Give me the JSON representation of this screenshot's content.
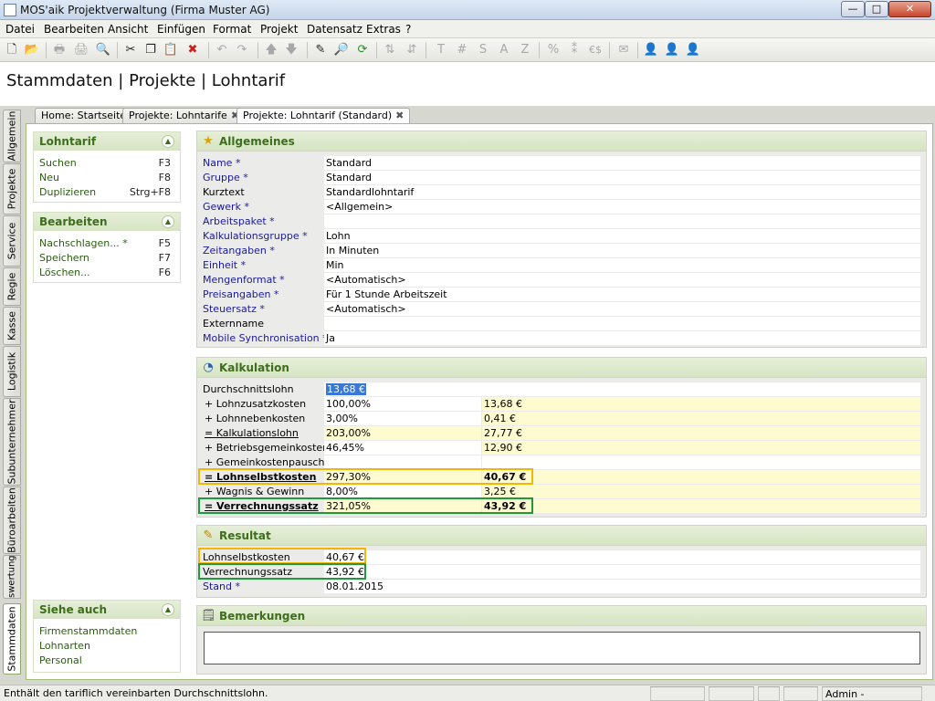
{
  "window": {
    "title": "MOS'aik Projektverwaltung (Firma Muster AG)",
    "buttons": {
      "minimize": "—",
      "maximize": "□",
      "close": "✕"
    }
  },
  "menu": [
    "Datei",
    "Bearbeiten",
    "Ansicht",
    "Einfügen",
    "Format",
    "Projekt",
    "Datensatz",
    "Extras",
    "?"
  ],
  "toolbar": {
    "icons": [
      {
        "name": "new-document-icon",
        "glyph": "🗋"
      },
      {
        "name": "open-folder-icon",
        "glyph": "📂"
      },
      {
        "name": "print-icon",
        "glyph": "🖶"
      },
      {
        "name": "print-setup-icon",
        "glyph": "🖨"
      },
      {
        "name": "print-preview-icon",
        "glyph": "🔍"
      },
      {
        "name": "cut-icon",
        "glyph": "✂"
      },
      {
        "name": "copy-icon",
        "glyph": "❐"
      },
      {
        "name": "paste-icon",
        "glyph": "📋"
      },
      {
        "name": "delete-icon",
        "glyph": "✖"
      },
      {
        "name": "undo-icon",
        "glyph": "↶"
      },
      {
        "name": "redo-icon",
        "glyph": "↷"
      },
      {
        "name": "move-up-icon",
        "glyph": "🡅"
      },
      {
        "name": "move-down-icon",
        "glyph": "🡇"
      },
      {
        "name": "edit-pencil-icon",
        "glyph": "✎"
      },
      {
        "name": "find-icon",
        "glyph": "🔎"
      },
      {
        "name": "refresh-icon",
        "glyph": "⟳"
      },
      {
        "name": "sort-ascending-icon",
        "glyph": "⇅"
      },
      {
        "name": "sort-descending-icon",
        "glyph": "⇵"
      },
      {
        "name": "text-format-icon",
        "glyph": "T"
      },
      {
        "name": "hash-format-icon",
        "glyph": "#"
      },
      {
        "name": "s-format-icon",
        "glyph": "S"
      },
      {
        "name": "a-format-icon",
        "glyph": "A"
      },
      {
        "name": "z-format-icon",
        "glyph": "Z"
      },
      {
        "name": "percent-icon",
        "glyph": "%"
      },
      {
        "name": "decimal-icon",
        "glyph": "⁑"
      },
      {
        "name": "currency-icon",
        "glyph": "€$"
      },
      {
        "name": "mail-icon",
        "glyph": "✉"
      },
      {
        "name": "user-blue-icon",
        "glyph": "👤"
      },
      {
        "name": "user-yellow-icon",
        "glyph": "👤"
      },
      {
        "name": "user-red-icon",
        "glyph": "👤"
      }
    ]
  },
  "page_heading": "Stammdaten | Projekte | Lohntarif",
  "vertical_tabs": [
    "Allgemein",
    "Projekte",
    "Service",
    "Regie",
    "Kasse",
    "Logistik",
    "Subunternehmer",
    "Büroarbeiten",
    "Auswertungen",
    "Stammdaten"
  ],
  "doc_tabs": [
    {
      "label": "Home: Startseite",
      "closable": false
    },
    {
      "label": "Projekte: Lohntarife",
      "closable": true
    },
    {
      "label": "Projekte: Lohntarif (Standard)",
      "closable": true
    }
  ],
  "close_glyph": "✖",
  "chevron_glyph": "▲",
  "left_panels": {
    "lohntarif": {
      "title": "Lohntarif",
      "items": [
        {
          "label": "Suchen",
          "key": "F3"
        },
        {
          "label": "Neu",
          "key": "F8"
        },
        {
          "label": "Duplizieren",
          "key": "Strg+F8"
        }
      ]
    },
    "bearbeiten": {
      "title": "Bearbeiten",
      "items": [
        {
          "label": "Nachschlagen... *",
          "key": "F5"
        },
        {
          "label": "Speichern",
          "key": "F7"
        },
        {
          "label": "Löschen...",
          "key": "F6"
        }
      ]
    },
    "siehe_auch": {
      "title": "Siehe auch",
      "items": [
        {
          "label": "Firmenstammdaten"
        },
        {
          "label": "Lohnarten"
        },
        {
          "label": "Personal"
        }
      ]
    }
  },
  "allgemeines": {
    "title": "Allgemeines",
    "icon": "★",
    "rows": [
      {
        "label": "Name *",
        "value": "Standard"
      },
      {
        "label": "Gruppe *",
        "value": "Standard"
      },
      {
        "label": "Kurztext",
        "value": "Standardlohntarif"
      },
      {
        "label": "Gewerk *",
        "value": "<Allgemein>"
      },
      {
        "label": "Arbeitspaket *",
        "value": ""
      },
      {
        "label": "Kalkulationsgruppe *",
        "value": "Lohn"
      },
      {
        "label": "Zeitangaben *",
        "value": "In Minuten"
      },
      {
        "label": "Einheit *",
        "value": "Min"
      },
      {
        "label": "Mengenformat *",
        "value": "<Automatisch>"
      },
      {
        "label": "Preisangaben *",
        "value": "Für 1 Stunde Arbeitszeit"
      },
      {
        "label": "Steuersatz *",
        "value": "<Automatisch>"
      },
      {
        "label": "Externname",
        "value": ""
      },
      {
        "label": "Mobile Synchronisation *",
        "value": "Ja"
      }
    ]
  },
  "kalkulation": {
    "title": "Kalkulation",
    "icon": "◔",
    "durchschnittslohn": {
      "label": "Durchschnittslohn",
      "value": "13,68 €"
    },
    "rows": [
      {
        "label": "+ Lohnzusatzkosten",
        "pct": "100,00%",
        "amount": "13,68 €"
      },
      {
        "label": "+ Lohnnebenkosten",
        "pct": "3,00%",
        "amount": "0,41 €"
      },
      {
        "label": "= Kalkulationslohn",
        "pct": "203,00%",
        "amount": "27,77 €"
      },
      {
        "label": "+ Betriebsgemeinkosten",
        "pct": "46,45%",
        "amount": "12,90 €"
      },
      {
        "label": "+ Gemeinkostenpauschale",
        "pct": "",
        "amount": ""
      },
      {
        "label": "= Lohnselbstkosten",
        "pct": "297,30%",
        "amount": "40,67 €"
      },
      {
        "label": "+ Wagnis & Gewinn",
        "pct": "8,00%",
        "amount": "3,25 €"
      },
      {
        "label": "= Verrechnungssatz",
        "pct": "321,05%",
        "amount": "43,92 €"
      }
    ]
  },
  "resultat": {
    "title": "Resultat",
    "icon": "✎",
    "rows": [
      {
        "label": "Lohnselbstkosten",
        "value": "40,67 €"
      },
      {
        "label": "Verrechnungssatz",
        "value": "43,92 €"
      },
      {
        "label": "Stand *",
        "value": "08.01.2015"
      }
    ]
  },
  "bemerkungen": {
    "title": "Bemerkungen",
    "icon": "🗒",
    "text": ""
  },
  "status": {
    "message": "Enthält den tariflich vereinbarten Durchschnittslohn.",
    "user": "Admin - Mosaik.mdb"
  },
  "colors": {
    "accent_green": "#3d6e1c",
    "highlight_orange": "#f2b705",
    "highlight_green": "#1f9a3a",
    "required_label": "#1a1a9c"
  }
}
